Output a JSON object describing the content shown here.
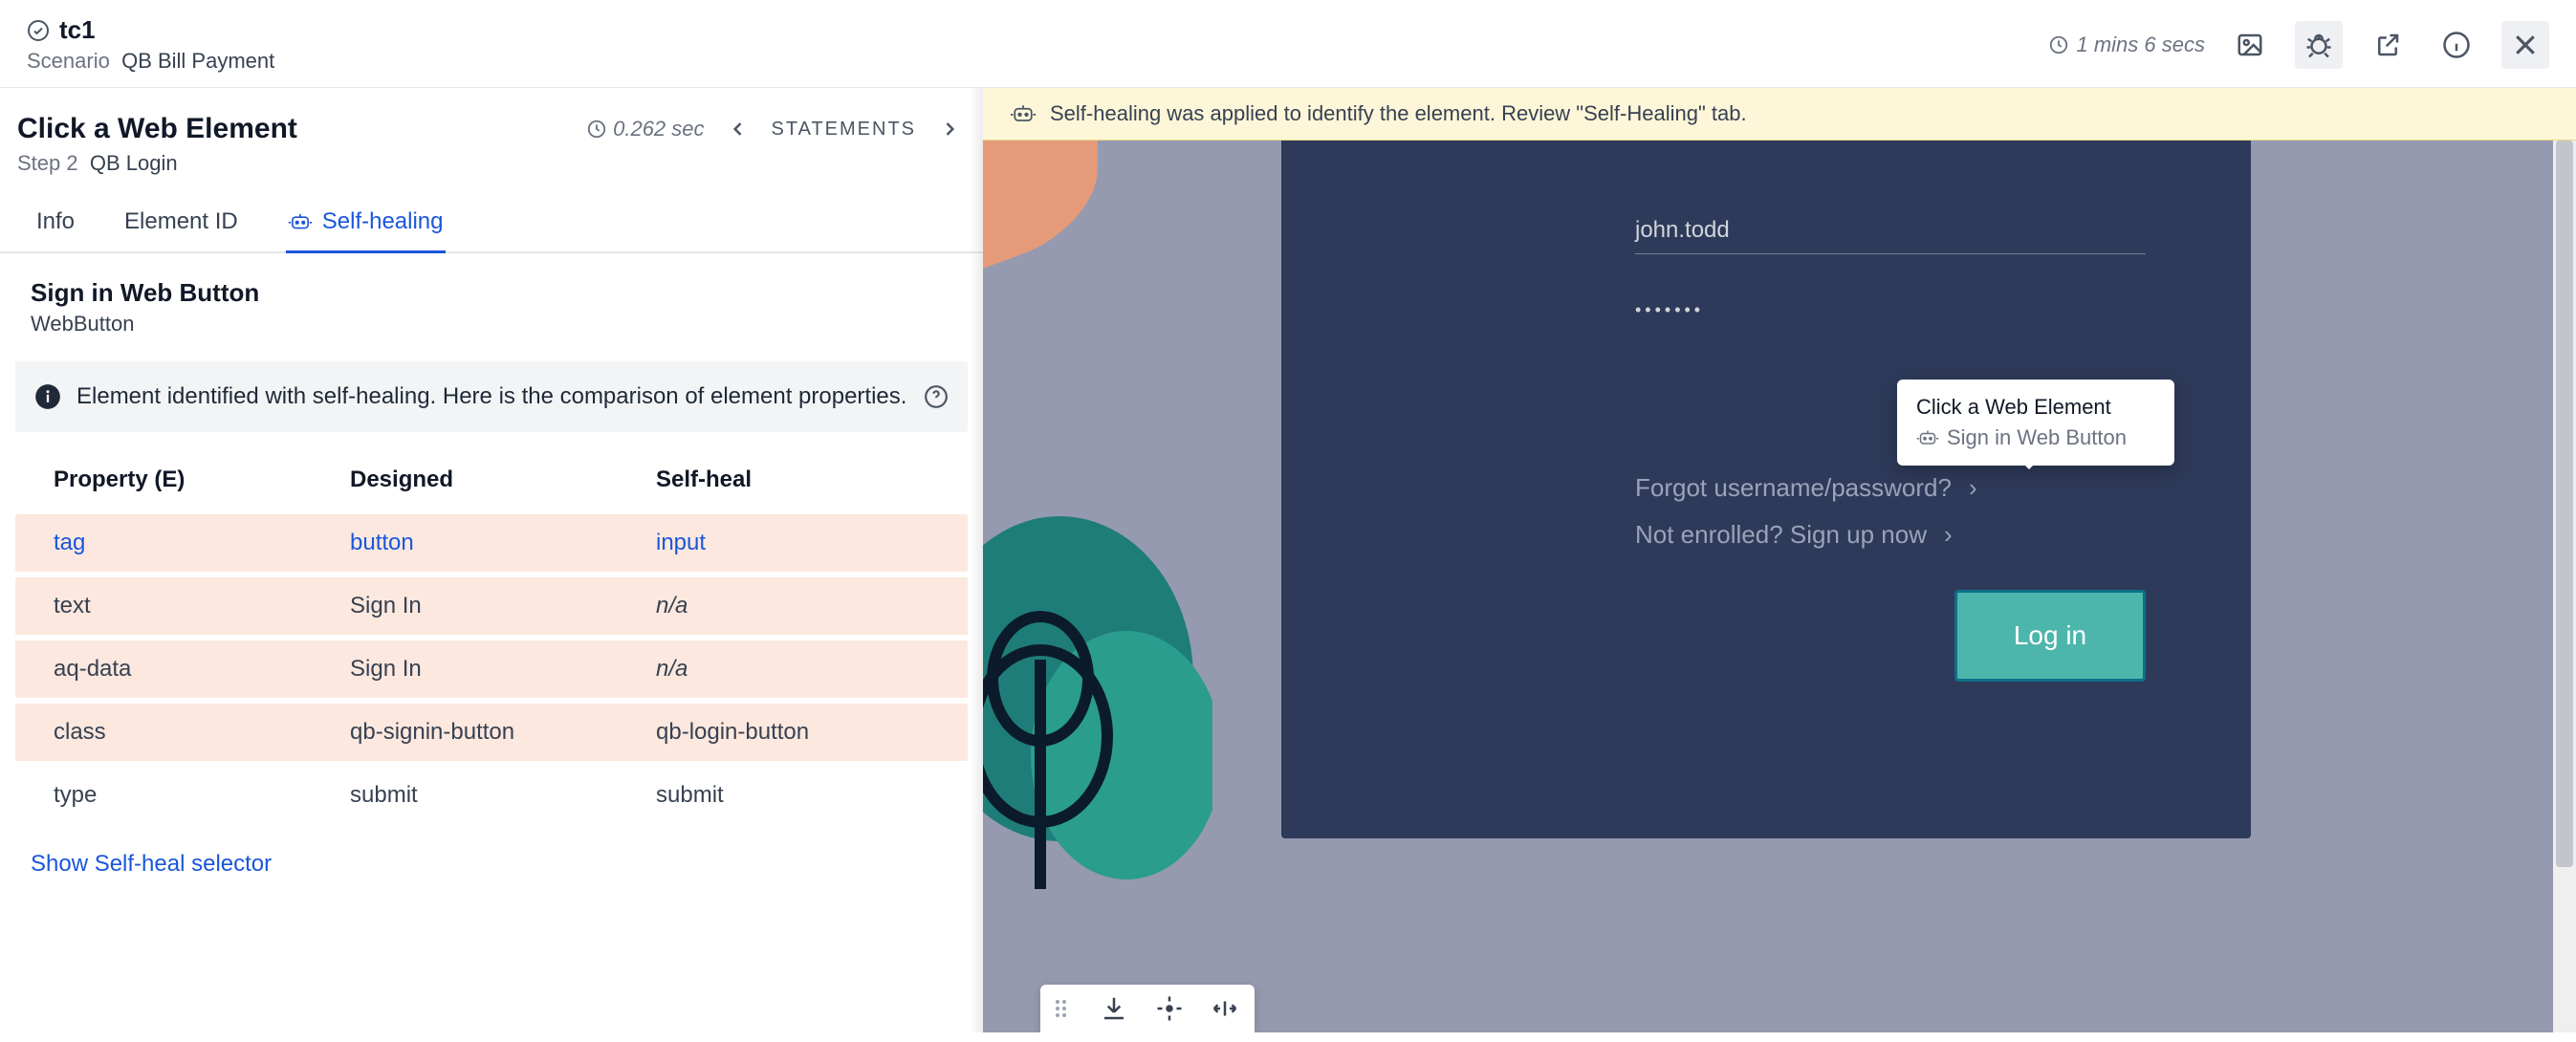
{
  "header": {
    "title": "tc1",
    "scenario_label": "Scenario",
    "scenario_value": "QB Bill Payment",
    "time": "1 mins 6 secs"
  },
  "step": {
    "title": "Click a Web Element",
    "step_label": "Step 2",
    "step_value": "QB Login",
    "time": "0.262 sec",
    "statements_label": "STATEMENTS"
  },
  "tabs": {
    "info": "Info",
    "element_id": "Element ID",
    "self_healing": "Self-healing"
  },
  "element": {
    "name": "Sign in Web Button",
    "type": "WebButton"
  },
  "info_panel": {
    "text": "Element identified with self-healing. Here is the comparison of element properties."
  },
  "table": {
    "headers": {
      "property": "Property (E)",
      "designed": "Designed",
      "self_heal": "Self-heal"
    },
    "rows": [
      {
        "property": "tag",
        "designed": "button",
        "self_heal": "input",
        "diff": true,
        "link": true
      },
      {
        "property": "text",
        "designed": "Sign In",
        "self_heal": "n/a",
        "diff": true,
        "na": true
      },
      {
        "property": "aq-data",
        "designed": "Sign In",
        "self_heal": "n/a",
        "diff": true,
        "na": true
      },
      {
        "property": "class",
        "designed": "qb-signin-button",
        "self_heal": "qb-login-button",
        "diff": true
      },
      {
        "property": "type",
        "designed": "submit",
        "self_heal": "submit",
        "diff": false
      }
    ]
  },
  "show_selector_link": "Show Self-heal selector",
  "banner": {
    "text": "Self-healing was applied to identify the element. Review \"Self-Healing\" tab."
  },
  "screenshot": {
    "username": "john.todd",
    "password_masked": "•••••••",
    "forgot": "Forgot username/password?",
    "enroll": "Not enrolled? Sign up now",
    "login_btn": "Log in"
  },
  "tooltip": {
    "title": "Click a Web Element",
    "subtitle": "Sign in Web Button"
  }
}
